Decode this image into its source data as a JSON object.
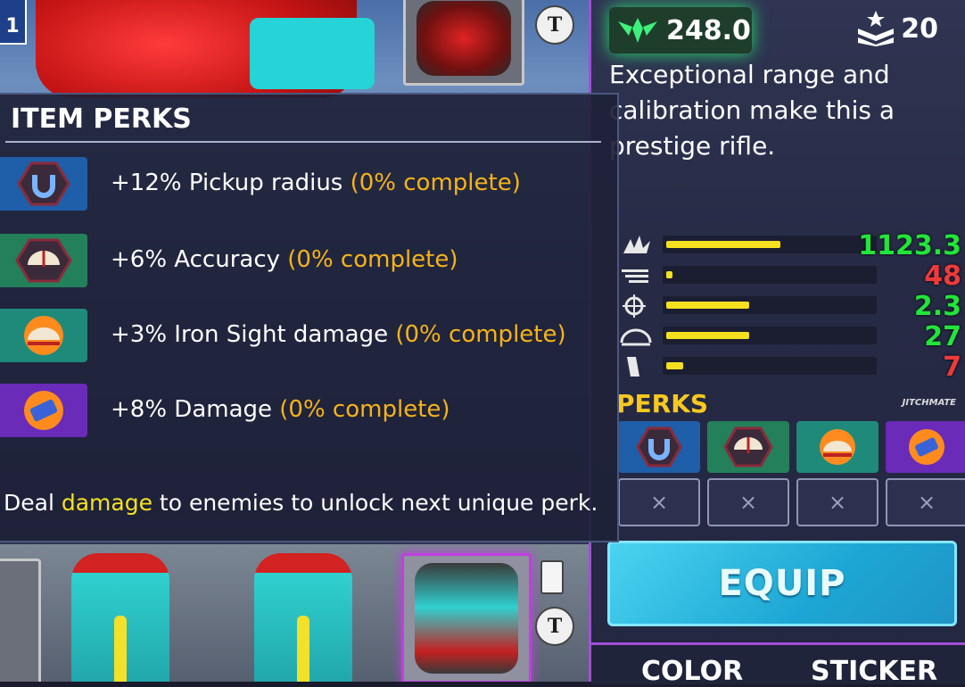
{
  "loadout": {
    "level_badge": "1",
    "badge_letter": "T"
  },
  "weapon": {
    "power_value": "248.0",
    "rank_value": "20",
    "description": "Exceptional range and calibration make this a prestige rifle.",
    "stats": [
      {
        "icon": "damage-icon",
        "value": "1123.3",
        "fill": 0.55,
        "color": "#22e53a"
      },
      {
        "icon": "fire-rate-icon",
        "value": "48",
        "fill": 0.03,
        "color": "#f03a3a"
      },
      {
        "icon": "accuracy-icon",
        "value": "2.3",
        "fill": 0.4,
        "color": "#22e53a"
      },
      {
        "icon": "range-icon",
        "value": "27",
        "fill": 0.4,
        "color": "#22e53a"
      },
      {
        "icon": "magazine-icon",
        "value": "7",
        "fill": 0.08,
        "color": "#f03a3a"
      }
    ],
    "perks_title": "PERKS",
    "manufacturer": "JITCHMATE",
    "perk_icons": [
      "magnet-icon",
      "accuracy-icon",
      "iron-sight-icon",
      "damage-icon"
    ],
    "locked_slot_symbol": "×",
    "equip_label": "EQUIP",
    "tabs": [
      "COLOR",
      "STICKER"
    ]
  },
  "popup": {
    "title": "ITEM PERKS",
    "perks": [
      {
        "icon": "magnet-icon",
        "label": "+12% Pickup radius",
        "progress": "(0% complete)"
      },
      {
        "icon": "accuracy-icon",
        "label": "+6% Accuracy",
        "progress": "(0% complete)"
      },
      {
        "icon": "iron-sight-icon",
        "label": "+3% Iron Sight damage",
        "progress": "(0% complete)"
      },
      {
        "icon": "damage-icon",
        "label": "+8% Damage",
        "progress": "(0% complete)"
      }
    ],
    "hint_before": "Deal ",
    "hint_highlight": "damage",
    "hint_after": " to enemies to unlock next unique perk."
  },
  "colors": {
    "accent_purple": "#a24ed8",
    "progress_orange": "#f7b318",
    "highlight_yellow": "#f7e020",
    "equip_blue": "#1da7d4",
    "stat_green": "#22e53a",
    "stat_red": "#f03a3a"
  }
}
